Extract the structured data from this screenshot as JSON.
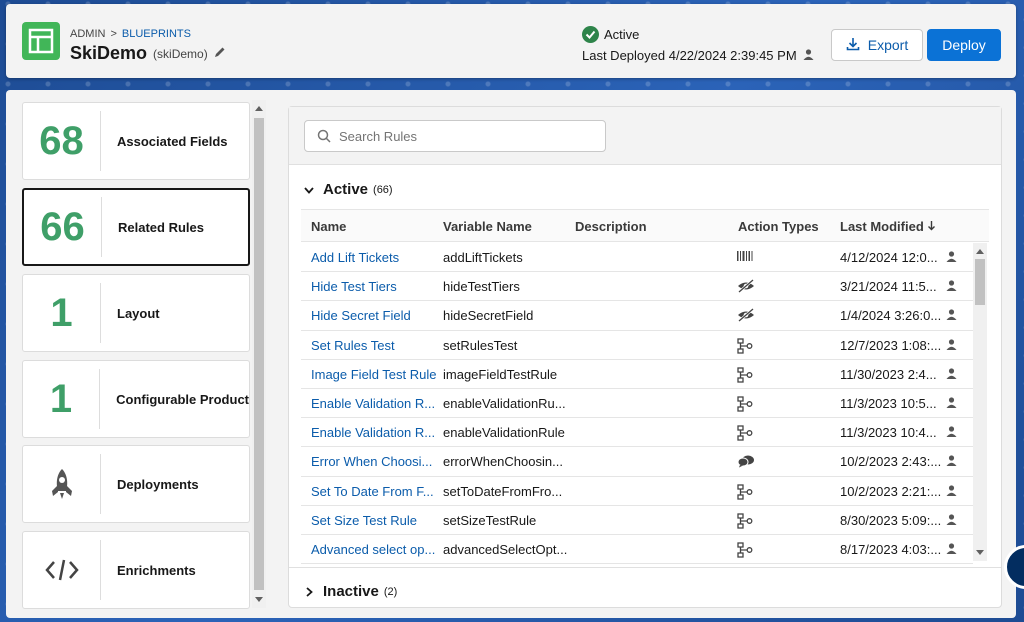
{
  "header": {
    "breadcrumb": {
      "root": "ADMIN",
      "separator": ">",
      "current": "BLUEPRINTS"
    },
    "title": "SkiDemo",
    "api_name": "(skiDemo)",
    "status": "Active",
    "last_deployed": "Last Deployed 4/22/2024 2:39:45 PM",
    "export_label": "Export",
    "deploy_label": "Deploy"
  },
  "sidebar": {
    "cards": [
      {
        "value": "68",
        "label": "Associated Fields"
      },
      {
        "value": "66",
        "label": "Related Rules"
      },
      {
        "value": "1",
        "label": "Layout"
      },
      {
        "value": "1",
        "label": "Configurable Product"
      },
      {
        "icon": "rocket-icon",
        "label": "Deployments"
      },
      {
        "icon": "code-icon",
        "label": "Enrichments"
      }
    ]
  },
  "search": {
    "placeholder": "Search Rules"
  },
  "sections": {
    "active": {
      "label": "Active",
      "count": "(66)"
    },
    "inactive": {
      "label": "Inactive",
      "count": "(2)"
    }
  },
  "table": {
    "headers": {
      "name": "Name",
      "variable": "Variable Name",
      "description": "Description",
      "action_types": "Action Types",
      "last_modified": "Last Modified"
    },
    "rows": [
      {
        "name": "Add Lift Tickets",
        "variable": "addLiftTickets",
        "action_icon": "barcode-icon",
        "modified": "4/12/2024 12:0..."
      },
      {
        "name": "Hide Test Tiers",
        "variable": "hideTestTiers",
        "action_icon": "hidden-eye-icon",
        "modified": "3/21/2024 11:5..."
      },
      {
        "name": "Hide Secret Field",
        "variable": "hideSecretField",
        "action_icon": "hidden-eye-icon",
        "modified": "1/4/2024 3:26:0..."
      },
      {
        "name": "Set Rules Test",
        "variable": "setRulesTest",
        "action_icon": "hierarchy-icon",
        "modified": "12/7/2023 1:08:..."
      },
      {
        "name": "Image Field Test Rule",
        "variable": "imageFieldTestRule",
        "action_icon": "hierarchy-icon",
        "modified": "11/30/2023 2:4..."
      },
      {
        "name": "Enable Validation R...",
        "variable": "enableValidationRu...",
        "action_icon": "hierarchy-icon",
        "modified": "11/3/2023 10:5..."
      },
      {
        "name": "Enable Validation R...",
        "variable": "enableValidationRule",
        "action_icon": "hierarchy-icon",
        "modified": "11/3/2023 10:4..."
      },
      {
        "name": "Error When Choosi...",
        "variable": "errorWhenChoosin...",
        "action_icon": "chat-icon",
        "modified": "10/2/2023 2:43:..."
      },
      {
        "name": "Set To Date From F...",
        "variable": "setToDateFromFro...",
        "action_icon": "hierarchy-icon",
        "modified": "10/2/2023 2:21:..."
      },
      {
        "name": "Set Size Test Rule",
        "variable": "setSizeTestRule",
        "action_icon": "hierarchy-icon",
        "modified": "8/30/2023 5:09:..."
      },
      {
        "name": "Advanced select op...",
        "variable": "advancedSelectOpt...",
        "action_icon": "hierarchy-icon",
        "modified": "8/17/2023 4:03:..."
      }
    ]
  },
  "colors": {
    "accent": "#0b5cab",
    "brand_green": "#41b658",
    "count_green": "#3f9f68",
    "deploy": "#0b72d6"
  }
}
